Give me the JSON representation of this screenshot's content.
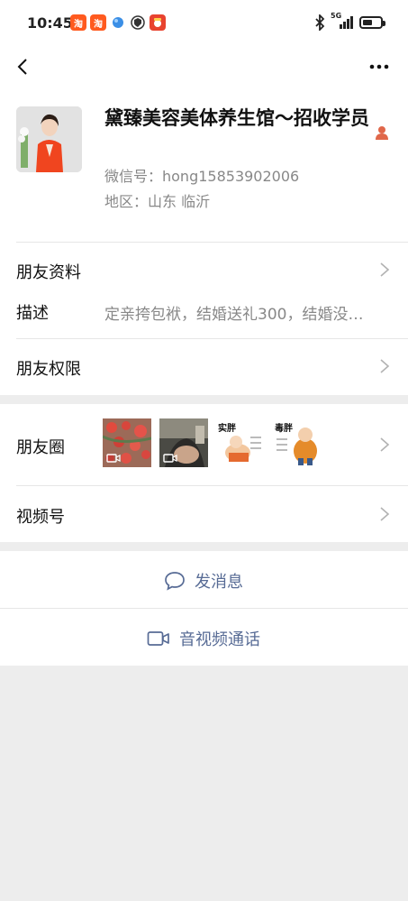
{
  "status_bar": {
    "time": "10:45",
    "apps": [
      "taobao-app-icon",
      "taobao-app-icon",
      "browser-app-icon",
      "shield-app-icon",
      "pinduoduo-app-icon"
    ],
    "app_labels": [
      "淘",
      "淘",
      "",
      "",
      ""
    ],
    "network": "5G"
  },
  "profile": {
    "name": "黛臻美容美体养生馆～招收学员",
    "wechat_id": "微信号：hong15853902006",
    "region": "地区：山东  临沂"
  },
  "rows": {
    "friend_info": "朋友资料",
    "description_label": "描述",
    "description_value": "定亲挎包袱，结婚送礼300，结婚没…",
    "permissions": "朋友权限",
    "moments": "朋友圈",
    "moments_photo_captions": [
      "",
      "",
      "实胖",
      "毒胖"
    ],
    "channels": "视频号"
  },
  "actions": {
    "message": "发消息",
    "call": "音视频通话"
  },
  "colors": {
    "link": "#576b95",
    "gender": "#e0674a"
  }
}
